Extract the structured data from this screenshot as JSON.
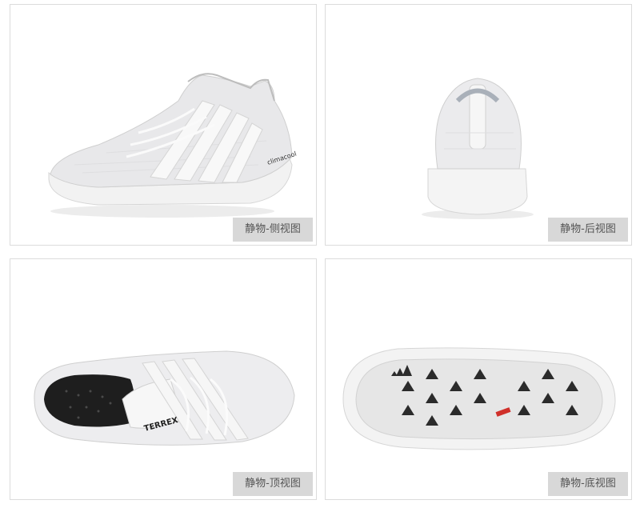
{
  "panels": [
    {
      "caption": "静物-侧视图",
      "brand_mark": "climacool"
    },
    {
      "caption": "静物-后视图"
    },
    {
      "caption": "静物-顶视图",
      "brand_mark": "TERREX"
    },
    {
      "caption": "静物-底视图"
    }
  ],
  "colors": {
    "panel_border": "#dcdcdc",
    "caption_bg": "#d8d8d8",
    "caption_text": "#555555",
    "sole_accent": "#d0302a"
  }
}
